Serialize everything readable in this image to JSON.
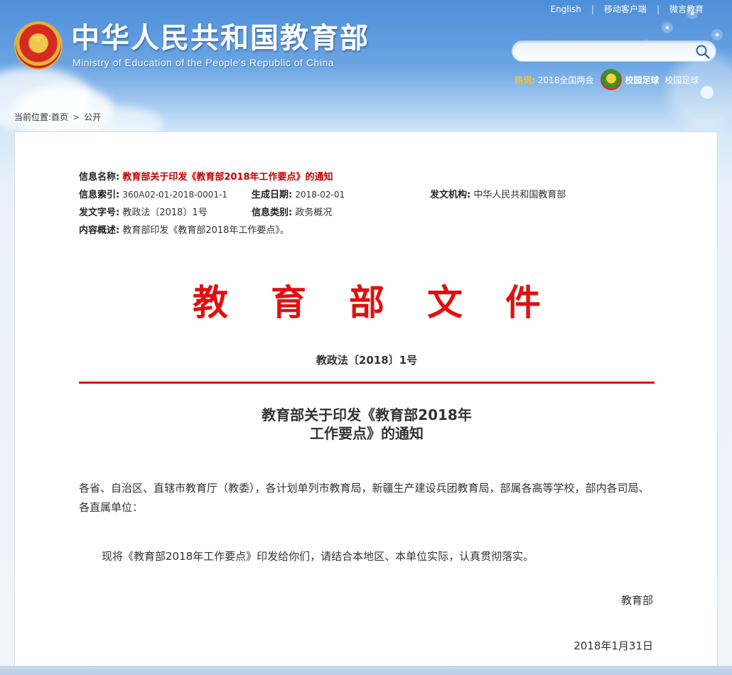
{
  "header": {
    "site_title": "中华人民共和国教育部",
    "site_subtitle": "Ministry of Education of the People's Republic of China",
    "top_links": [
      "English",
      "移动客户端",
      "微言教育"
    ],
    "search": {
      "placeholder": ""
    },
    "hot_label": "热词:",
    "hot_items": [
      "2018全国两会",
      "校园足球",
      "校园足球"
    ]
  },
  "breadcrumb": {
    "prefix": "当前位置:",
    "items": [
      "首页",
      "公开"
    ]
  },
  "meta": {
    "name_key": "信息名称:",
    "name_value": "教育部关于印发《教育部2018年工作要点》的通知",
    "index_key": "信息索引:",
    "index_value": "360A02-01-2018-0001-1",
    "date_key": "生成日期:",
    "date_value": "2018-02-01",
    "org_key": "发文机构:",
    "org_value": "中华人民共和国教育部",
    "docno_key": "发文字号:",
    "docno_value": "教政法〔2018〕1号",
    "category_key": "信息类别:",
    "category_value": "政务概况",
    "summary_key": "内容概述:",
    "summary_value": "教育部印发《教育部2018年工作要点》。"
  },
  "document": {
    "header": "教育部文件",
    "number": "教政法〔2018〕1号",
    "title_line1": "教育部关于印发《教育部2018年",
    "title_line2": "工作要点》的通知",
    "salutation": "各省、自治区、直辖市教育厅（教委），各计划单列市教育局，新疆生产建设兵团教育局，部属各高等学校，部内各司局、各直属单位：",
    "paragraph": "现将《教育部2018年工作要点》印发给你们，请结合本地区、本单位实际，认真贯彻落实。",
    "signature": "教育部",
    "date": "2018年1月31日"
  },
  "colors": {
    "accent_red": "#e01010",
    "meta_red": "#c00000",
    "sky_blue": "#4d8fd8"
  },
  "icons": [
    "national-emblem-icon",
    "search-icon",
    "campus-football-icon"
  ]
}
